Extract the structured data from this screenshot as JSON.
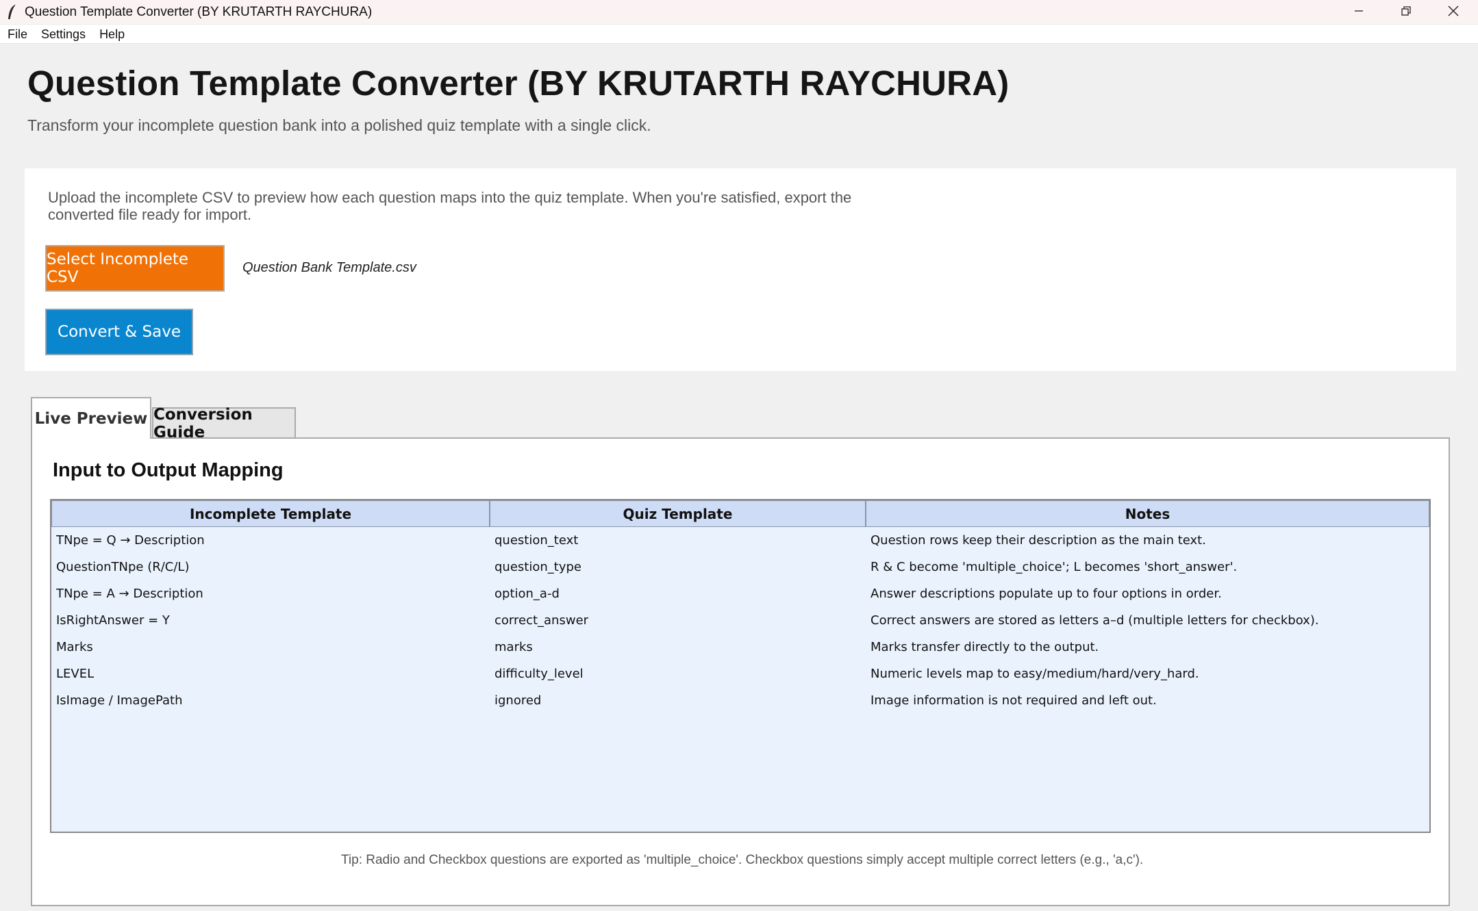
{
  "window": {
    "title": "Question Template Converter (BY KRUTARTH RAYCHURA)"
  },
  "menu": [
    "File",
    "Settings",
    "Help"
  ],
  "header": {
    "title": "Question Template Converter (BY KRUTARTH RAYCHURA)",
    "subtitle": "Transform your incomplete question bank into a polished quiz template with a single click."
  },
  "upload": {
    "description": "Upload the incomplete CSV to preview how each question maps into the quiz template. When you're satisfied, export the converted file ready for import.",
    "select_button": "Select Incomplete CSV",
    "selected_file": "Question Bank Template.csv",
    "convert_button": "Convert & Save",
    "select_color": "#f07207",
    "convert_color": "#0a86cf"
  },
  "tabs": [
    {
      "label": "Live Preview",
      "active": true
    },
    {
      "label": "Conversion Guide",
      "active": false
    }
  ],
  "mapping": {
    "title": "Input to Output Mapping",
    "columns": [
      "Incomplete Template",
      "Quiz Template",
      "Notes"
    ],
    "rows": [
      [
        "TNpe = Q → Description",
        "question_text",
        "Question rows keep their description as the main text."
      ],
      [
        "QuestionTNpe (R/C/L)",
        "question_type",
        "R & C become 'multiple_choice'; L becomes 'short_answer'."
      ],
      [
        "TNpe = A → Description",
        "option_a-d",
        "Answer descriptions populate up to four options in order."
      ],
      [
        "IsRightAnswer = Y",
        "correct_answer",
        "Correct answers are stored as letters a–d (multiple letters for checkbox)."
      ],
      [
        "Marks",
        "marks",
        "Marks transfer directly to the output."
      ],
      [
        "LEVEL",
        "difficulty_level",
        "Numeric levels map to easy/medium/hard/very_hard."
      ],
      [
        "IsImage / ImagePath",
        "ignored",
        "Image information is not required and left out."
      ]
    ],
    "tip": "Tip: Radio and Checkbox questions are exported as 'multiple_choice'. Checkbox questions simply accept multiple correct letters (e.g., 'a,c')."
  }
}
